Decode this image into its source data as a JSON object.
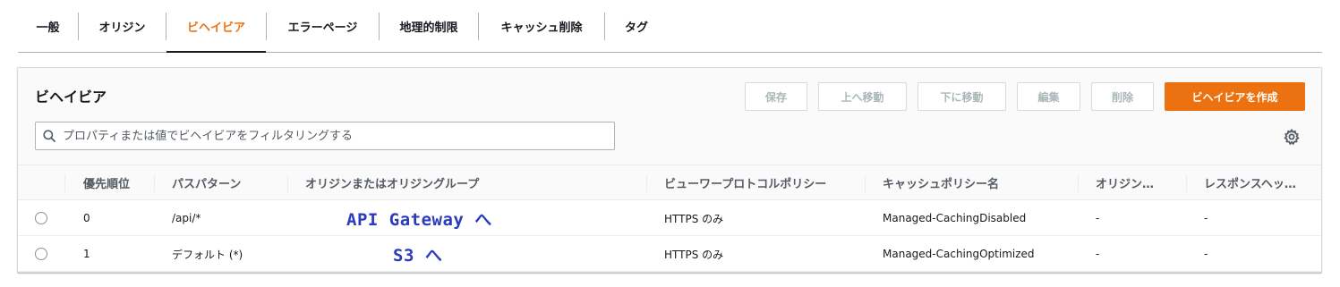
{
  "tabs": [
    {
      "label": "一般"
    },
    {
      "label": "オリジン"
    },
    {
      "label": "ビヘイビア"
    },
    {
      "label": "エラーページ"
    },
    {
      "label": "地理的制限"
    },
    {
      "label": "キャッシュ削除"
    },
    {
      "label": "タグ"
    }
  ],
  "active_tab": "ビヘイビア",
  "panel": {
    "title": "ビヘイビア",
    "buttons": {
      "save": "保存",
      "move_up": "上へ移動",
      "move_down": "下に移動",
      "edit": "編集",
      "delete": "削除",
      "create": "ビヘイビアを作成"
    },
    "search_placeholder": "プロパティまたは値でビヘイビアをフィルタリングする"
  },
  "table": {
    "columns": [
      "優先順位",
      "パスパターン",
      "オリジンまたはオリジングループ",
      "ビューワープロトコルポリシー",
      "キャッシュポリシー名",
      "オリジン…",
      "レスポンスヘッ…"
    ],
    "rows": [
      {
        "precedence": "0",
        "path": "/api/*",
        "origin_annotation": "API Gateway へ",
        "viewer_protocol": "HTTPS のみ",
        "cache_policy": "Managed-CachingDisabled",
        "origin_req": "-",
        "response_headers": "-"
      },
      {
        "precedence": "1",
        "path": "デフォルト (*)",
        "origin_annotation": "S3 へ",
        "viewer_protocol": "HTTPS のみ",
        "cache_policy": "Managed-CachingOptimized",
        "origin_req": "-",
        "response_headers": "-"
      }
    ]
  },
  "colors": {
    "accent": "#ec7211",
    "annotation": "#2b3bbd"
  }
}
